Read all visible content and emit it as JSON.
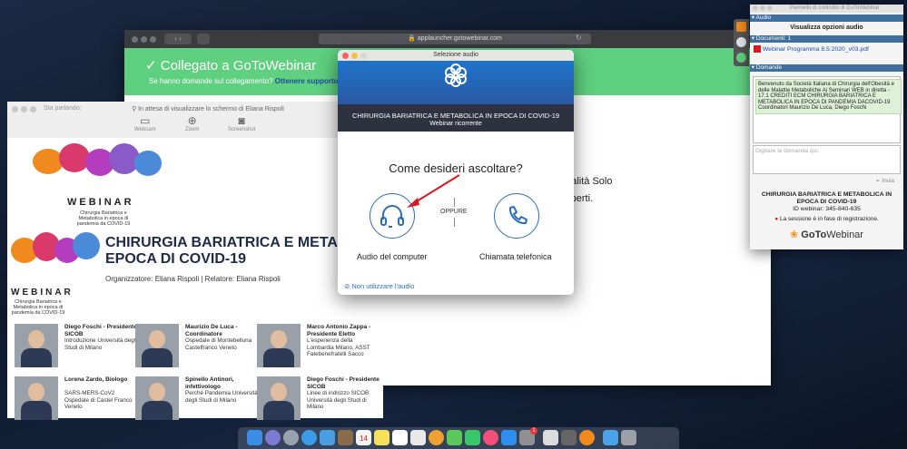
{
  "safari": {
    "url": "applauncher.gotowebinar.com",
    "connected_title": "Collegato a GoToWebinar",
    "connected_sub": "Se hanno domande sul collegamento?",
    "support_link": "Ottenere supporto",
    "body_line1": "odalità Solo",
    "body_line2": "esperti.",
    "body_line3": "uti."
  },
  "viewer": {
    "speaking_label": "Sta parlando:",
    "waiting_text": "In attesa di visualizzare lo schermo di Eliana Rispoli",
    "tools": [
      {
        "label": "Webcam",
        "icon": "webcam-icon"
      },
      {
        "label": "Zoom",
        "icon": "zoom-icon"
      },
      {
        "label": "Screenshot",
        "icon": "camera-icon"
      }
    ]
  },
  "slide": {
    "webinar_word": "WEBINAR",
    "webinar_sub": "Chirurgia Bariatrica e Metabolica in epoca di pandemia da COVID-19",
    "title_line1": "CHIRURGIA BARIATRICA E METABOLI",
    "title_line2": "EPOCA DI COVID-19",
    "organizer": "Organizzatore: Eliana Rispoli | Relatore: Eliana Rispoli",
    "speakers": [
      {
        "name": "Diego Foschi - Presidente SICOB",
        "desc": "Introduzione Università degli Studi di Milano"
      },
      {
        "name": "Maurizio De Luca - Coordinatore",
        "desc": "Ospedale di Montebelluna Castelfranco Veneto"
      },
      {
        "name": "Marco Antonio Zappa - Presidente Eletto",
        "desc": "L'esperienza della Lombardia Milano, ASST Fatebenefratelli Sacco"
      },
      {
        "name": "Lorena Zardo, Biologo",
        "desc": "SARS-MERS-CoV2 Ospedale di Castel Franco Veneto"
      },
      {
        "name": "Spinello Antinori, infettivologo",
        "desc": "Perché Pandemia Università degli Studi di Milano"
      },
      {
        "name": "Diego Foschi - Presidente SICOB",
        "desc": "Linee di indirizzo SICOB Università degli Studi di Milano"
      }
    ]
  },
  "audio": {
    "window_title": "Selezione audio",
    "event_title": "CHIRURGIA BARIATRICA E METABOLICA IN EPOCA DI COVID-19",
    "event_type": "Webinar ricorrente",
    "question": "Come desideri ascoltare?",
    "or": "OPPURE",
    "option_computer": "Audio del computer",
    "option_phone": "Chiamata telefonica",
    "no_audio": "Non utilizzare l'audio",
    "accent": "#2b6fb8"
  },
  "panel": {
    "title": "Pannello di controllo di GoToWebinar",
    "audio_section": "Audio",
    "audio_options": "Visualizza opzioni audio",
    "documents_section": "Documenti: 1",
    "document_name": "Webinar Programma 8.5.2020_v03.pdf",
    "questions_section": "Domande",
    "question_message": "Benvenuto da Società Italiana di Chirurgia dell'Obesità e delle Malattie Metaboliche Ai Seminari WEB in diretta - 17.1 CREDITI ECM CHIRURGIA BARIATRICA E METABOLICA IN EPOCA DI PANDEMIA DACOVID-19 Coordinatori Maurizio De Luca, Diego Foschi",
    "input_placeholder": "Digitare la domanda qui.",
    "send": "Invia",
    "event_name": "CHIRURGIA BARIATRICA E METABOLICA IN EPOCA DI COVID-19",
    "webinar_id": "ID webinar: 345-840-635",
    "recording": "La sessione è in fase di registrazione.",
    "brand_bold": "GoTo",
    "brand_rest": "Webinar",
    "section_color": "#3f6f9f"
  },
  "dock": {
    "badge_count": "1",
    "calendar_day": "14"
  }
}
